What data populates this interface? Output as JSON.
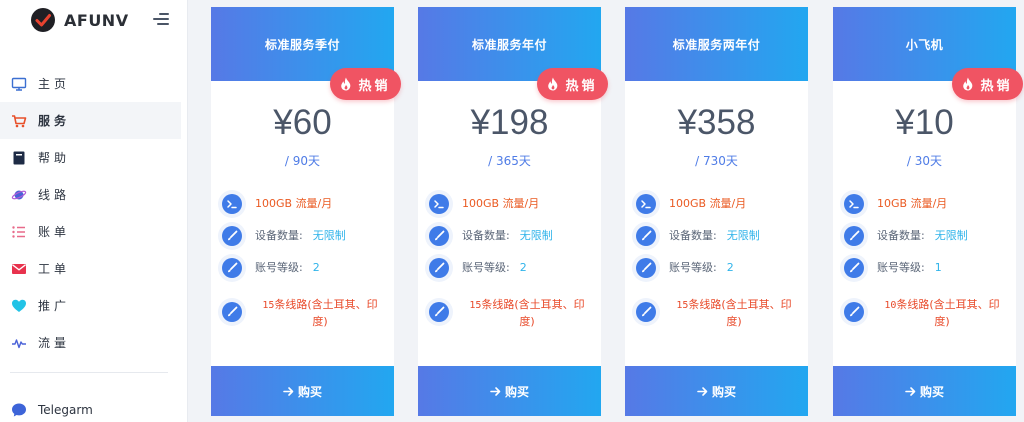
{
  "brand": {
    "name": "AFUNV"
  },
  "nav": [
    {
      "label": "主页",
      "icon": "monitor-icon"
    },
    {
      "label": "服务",
      "icon": "cart-icon",
      "active": true
    },
    {
      "label": "帮助",
      "icon": "book-icon"
    },
    {
      "label": "线路",
      "icon": "planet-icon"
    },
    {
      "label": "账单",
      "icon": "list-icon"
    },
    {
      "label": "工单",
      "icon": "mail-icon"
    },
    {
      "label": "推广",
      "icon": "heart-icon"
    },
    {
      "label": "流量",
      "icon": "pulse-icon"
    }
  ],
  "telegram": {
    "label": "Telegarm",
    "icon": "chat-bubble-icon"
  },
  "plans": [
    {
      "name": "标准服务季付",
      "hot": true,
      "hot_label": "热销",
      "price": "¥60",
      "period": "/ 90天",
      "traffic": "100GB 流量/月",
      "devices_label": "设备数量:",
      "devices_value": "无限制",
      "level_label": "账号等级:",
      "level_value": "2",
      "lines_count": "15",
      "lines_text": "条线路(含土耳其、印度)",
      "buy_label": "购买"
    },
    {
      "name": "标准服务年付",
      "hot": true,
      "hot_label": "热销",
      "price": "¥198",
      "period": "/ 365天",
      "traffic": "100GB 流量/月",
      "devices_label": "设备数量:",
      "devices_value": "无限制",
      "level_label": "账号等级:",
      "level_value": "2",
      "lines_count": "15",
      "lines_text": "条线路(含土耳其、印度)",
      "buy_label": "购买"
    },
    {
      "name": "标准服务两年付",
      "hot": false,
      "hot_label": "",
      "price": "¥358",
      "period": "/ 730天",
      "traffic": "100GB 流量/月",
      "devices_label": "设备数量:",
      "devices_value": "无限制",
      "level_label": "账号等级:",
      "level_value": "2",
      "lines_count": "15",
      "lines_text": "条线路(含土耳其、印度)",
      "buy_label": "购买"
    },
    {
      "name": "小飞机",
      "hot": true,
      "hot_label": "热销",
      "price": "¥10",
      "period": "/ 30天",
      "traffic": "10GB 流量/月",
      "devices_label": "设备数量:",
      "devices_value": "无限制",
      "level_label": "账号等级:",
      "level_value": "1",
      "lines_count": "10",
      "lines_text": "条线路(含土耳其、印度)",
      "buy_label": "购买"
    }
  ],
  "colors": {
    "accent_start": "#5679e6",
    "accent_end": "#22a7f0",
    "hot": "#f05463",
    "traffic": "#ea5a22",
    "value": "#2fb3ea"
  }
}
